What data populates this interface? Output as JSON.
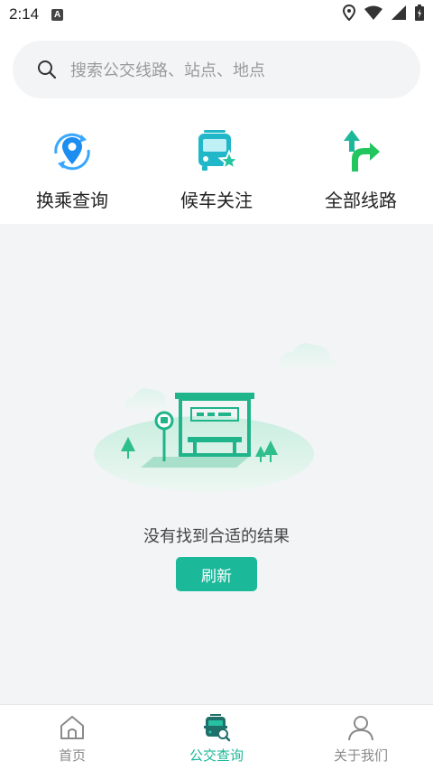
{
  "status_bar": {
    "time": "2:14",
    "notification_letter": "A"
  },
  "search": {
    "placeholder": "搜索公交线路、站点、地点"
  },
  "quick_actions": [
    {
      "label": "换乘查询",
      "icon": "transfer-location-icon"
    },
    {
      "label": "候车关注",
      "icon": "bus-star-icon"
    },
    {
      "label": "全部线路",
      "icon": "route-split-arrow-icon"
    }
  ],
  "empty_state": {
    "message": "没有找到合适的结果",
    "refresh_label": "刷新",
    "illustration": "bus-stop-illustration"
  },
  "bottom_nav": {
    "items": [
      {
        "label": "首页",
        "icon": "home-icon",
        "active": false
      },
      {
        "label": "公交查询",
        "icon": "bus-search-icon",
        "active": true
      },
      {
        "label": "关于我们",
        "icon": "user-icon",
        "active": false
      }
    ]
  },
  "colors": {
    "accent": "#1bb89a",
    "background": "#f3f4f6",
    "nav_inactive": "#8a8a8a"
  }
}
